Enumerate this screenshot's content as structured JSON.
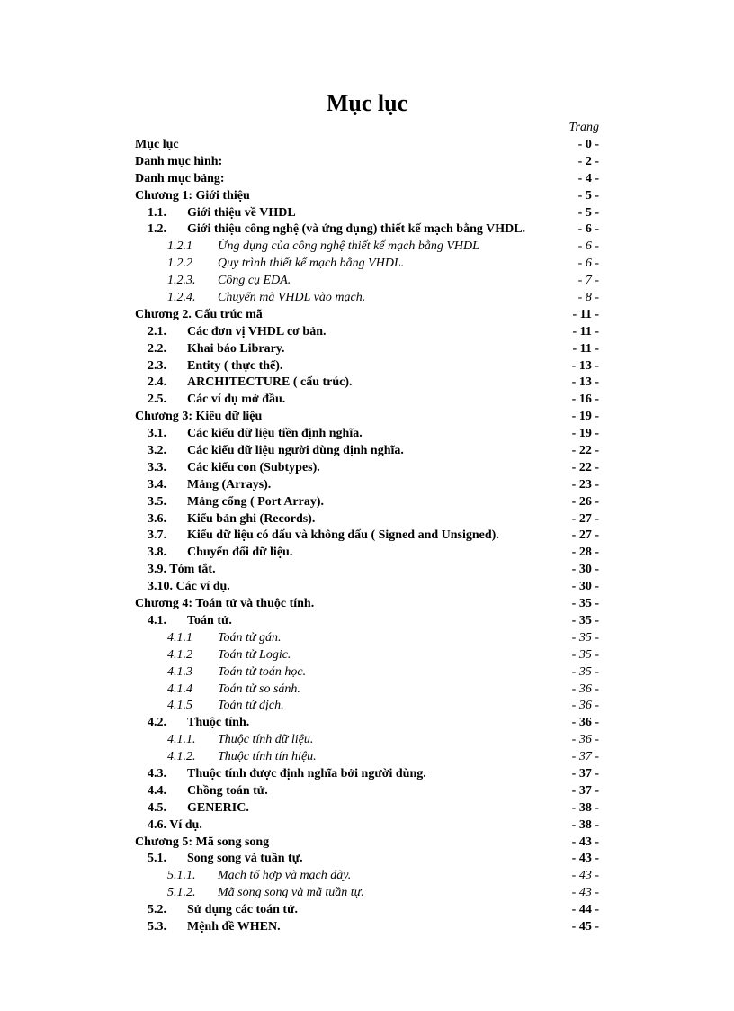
{
  "title": "Mục lục",
  "page_label": "Trang",
  "entries": [
    {
      "indent": 0,
      "bold": true,
      "italic": false,
      "num": "",
      "label": "Mục lục",
      "page": "- 0 -",
      "numClass": ""
    },
    {
      "indent": 0,
      "bold": true,
      "italic": false,
      "num": "",
      "label": "Danh mục hình:",
      "page": "- 2 -",
      "numClass": ""
    },
    {
      "indent": 0,
      "bold": true,
      "italic": false,
      "num": "",
      "label": "Danh mục bảng:",
      "page": "- 4 -",
      "numClass": ""
    },
    {
      "indent": 0,
      "bold": true,
      "italic": false,
      "num": "",
      "label": "Chương 1: Giới thiệu",
      "page": "- 5 -",
      "numClass": ""
    },
    {
      "indent": 1,
      "bold": true,
      "italic": false,
      "num": "1.1.",
      "label": "Giới thiệu về VHDL",
      "page": "- 5 -",
      "numClass": "num-col"
    },
    {
      "indent": 1,
      "bold": true,
      "italic": false,
      "num": "1.2.",
      "label": "Giới thiệu công nghệ (và ứng dụng) thiết kế mạch bằng VHDL. ",
      "page": "- 6 -",
      "numClass": "num-col",
      "shortLeader": true
    },
    {
      "indent": 2,
      "bold": false,
      "italic": true,
      "num": "1.2.1",
      "label": "Ứng dụng của công nghệ thiết kế mạch bằng VHDL",
      "page": "- 6 -",
      "numClass": "num-col-wide"
    },
    {
      "indent": 2,
      "bold": false,
      "italic": true,
      "num": "1.2.2",
      "label": "Quy trình thiết kế mạch bằng VHDL.",
      "page": "- 6 -",
      "numClass": "num-col-wide"
    },
    {
      "indent": 2,
      "bold": false,
      "italic": true,
      "num": "1.2.3.",
      "label": "Công cụ EDA.",
      "page": "- 7 -",
      "numClass": "num-col-wide"
    },
    {
      "indent": 2,
      "bold": false,
      "italic": true,
      "num": "1.2.4.",
      "label": "Chuyển mã VHDL vào mạch.",
      "page": "- 8 -",
      "numClass": "num-col-wide"
    },
    {
      "indent": 0,
      "bold": true,
      "italic": false,
      "num": "",
      "label": "Chương 2. Cấu trúc mã",
      "page": "- 11 -",
      "numClass": ""
    },
    {
      "indent": 1,
      "bold": true,
      "italic": false,
      "num": "2.1.",
      "label": "Các đơn vị VHDL cơ bản.",
      "page": "- 11 -",
      "numClass": "num-col"
    },
    {
      "indent": 1,
      "bold": true,
      "italic": false,
      "num": "2.2.",
      "label": "Khai báo Library.",
      "page": "- 11 -",
      "numClass": "num-col"
    },
    {
      "indent": 1,
      "bold": true,
      "italic": false,
      "num": "2.3.",
      "label": "Entity ( thực thể).",
      "page": "- 13 -",
      "numClass": "num-col"
    },
    {
      "indent": 1,
      "bold": true,
      "italic": false,
      "num": "2.4.",
      "label": "ARCHITECTURE ( cấu trúc).",
      "page": "- 13 -",
      "numClass": "num-col"
    },
    {
      "indent": 1,
      "bold": true,
      "italic": false,
      "num": "2.5.",
      "label": "Các ví dụ mở đầu.",
      "page": "- 16 -",
      "numClass": "num-col"
    },
    {
      "indent": 0,
      "bold": true,
      "italic": false,
      "num": "",
      "label": "Chương 3: Kiểu dữ liệu",
      "page": "- 19 -",
      "numClass": ""
    },
    {
      "indent": 1,
      "bold": true,
      "italic": false,
      "num": "3.1.",
      "label": "Các kiểu dữ liệu tiền định nghĩa.",
      "page": "- 19 -",
      "numClass": "num-col"
    },
    {
      "indent": 1,
      "bold": true,
      "italic": false,
      "num": "3.2.",
      "label": "Các kiểu dữ liệu người dùng định nghĩa.",
      "page": "- 22 -",
      "numClass": "num-col"
    },
    {
      "indent": 1,
      "bold": true,
      "italic": false,
      "num": "3.3.",
      "label": "Các kiểu con (Subtypes).",
      "page": "- 22 -",
      "numClass": "num-col"
    },
    {
      "indent": 1,
      "bold": true,
      "italic": false,
      "num": "3.4.",
      "label": "Mảng (Arrays).",
      "page": "- 23 -",
      "numClass": "num-col"
    },
    {
      "indent": 1,
      "bold": true,
      "italic": false,
      "num": "3.5.",
      "label": "Mảng cổng ( Port Array).",
      "page": "- 26 -",
      "numClass": "num-col"
    },
    {
      "indent": 1,
      "bold": true,
      "italic": false,
      "num": "3.6.",
      "label": "Kiểu bản ghi (Records).",
      "page": "- 27 -",
      "numClass": "num-col"
    },
    {
      "indent": 1,
      "bold": true,
      "italic": false,
      "num": "3.7.",
      "label": "Kiểu dữ liệu có dấu và không dấu ( Signed and Unsigned).",
      "page": "- 27 -",
      "numClass": "num-col"
    },
    {
      "indent": 1,
      "bold": true,
      "italic": false,
      "num": "3.8.",
      "label": "Chuyển đổi dữ liệu.",
      "page": "- 28 -",
      "numClass": "num-col"
    },
    {
      "indent": 1,
      "bold": true,
      "italic": false,
      "num": "",
      "label": "3.9. Tóm tắt.",
      "page": "- 30 -",
      "numClass": ""
    },
    {
      "indent": 1,
      "bold": true,
      "italic": false,
      "num": "",
      "label": "3.10. Các ví dụ.",
      "page": "- 30 -",
      "numClass": ""
    },
    {
      "indent": 0,
      "bold": true,
      "italic": false,
      "num": "",
      "label": "Chương 4: Toán tử và thuộc tính.",
      "page": "- 35 -",
      "numClass": ""
    },
    {
      "indent": 1,
      "bold": true,
      "italic": false,
      "num": "4.1.",
      "label": "Toán tử.",
      "page": "- 35 -",
      "numClass": "num-col"
    },
    {
      "indent": 2,
      "bold": false,
      "italic": true,
      "num": "4.1.1",
      "label": "Toán tử gán.",
      "page": "- 35 -",
      "numClass": "num-col-wide"
    },
    {
      "indent": 2,
      "bold": false,
      "italic": true,
      "num": "4.1.2",
      "label": "Toán tử Logic.",
      "page": "- 35 -",
      "numClass": "num-col-wide"
    },
    {
      "indent": 2,
      "bold": false,
      "italic": true,
      "num": "4.1.3",
      "label": "Toán tử toán học.",
      "page": "- 35 -",
      "numClass": "num-col-wide"
    },
    {
      "indent": 2,
      "bold": false,
      "italic": true,
      "num": "4.1.4",
      "label": "Toán tử so sánh.",
      "page": "- 36 -",
      "numClass": "num-col-wide"
    },
    {
      "indent": 2,
      "bold": false,
      "italic": true,
      "num": "4.1.5",
      "label": "Toán tử dịch.",
      "page": "- 36 -",
      "numClass": "num-col-wide"
    },
    {
      "indent": 1,
      "bold": true,
      "italic": false,
      "num": "4.2.",
      "label": "Thuộc tính.",
      "page": "- 36 -",
      "numClass": "num-col"
    },
    {
      "indent": 2,
      "bold": false,
      "italic": true,
      "num": "4.1.1.",
      "label": "Thuộc tính dữ liệu.",
      "page": "- 36 -",
      "numClass": "num-col-wide"
    },
    {
      "indent": 2,
      "bold": false,
      "italic": true,
      "num": "4.1.2.",
      "label": "Thuộc tính tín hiệu.",
      "page": "- 37 -",
      "numClass": "num-col-wide"
    },
    {
      "indent": 1,
      "bold": true,
      "italic": false,
      "num": "4.3.",
      "label": "Thuộc tính được định nghĩa bởi người dùng.",
      "page": "- 37 -",
      "numClass": "num-col"
    },
    {
      "indent": 1,
      "bold": true,
      "italic": false,
      "num": "4.4.",
      "label": "Chồng toán tử.",
      "page": "- 37 -",
      "numClass": "num-col"
    },
    {
      "indent": 1,
      "bold": true,
      "italic": false,
      "num": "4.5.",
      "label": "GENERIC.",
      "page": "- 38 -",
      "numClass": "num-col"
    },
    {
      "indent": 1,
      "bold": true,
      "italic": false,
      "num": "",
      "label": "4.6. Ví dụ.",
      "page": "- 38 -",
      "numClass": ""
    },
    {
      "indent": 0,
      "bold": true,
      "italic": false,
      "num": "",
      "label": "Chương 5: Mã song song",
      "page": "- 43 -",
      "numClass": ""
    },
    {
      "indent": 1,
      "bold": true,
      "italic": false,
      "num": "5.1.",
      "label": "Song song và tuần tự.",
      "page": "- 43 -",
      "numClass": "num-col"
    },
    {
      "indent": 2,
      "bold": false,
      "italic": true,
      "num": "5.1.1.",
      "label": "Mạch tổ hợp và mạch dãy.",
      "page": "- 43 -",
      "numClass": "num-col-wide"
    },
    {
      "indent": 2,
      "bold": false,
      "italic": true,
      "num": "5.1.2.",
      "label": "Mã song song và mã tuần tự.",
      "page": "- 43 -",
      "numClass": "num-col-wide"
    },
    {
      "indent": 1,
      "bold": true,
      "italic": false,
      "num": "5.2.",
      "label": "Sử dụng các toán tử.",
      "page": "- 44 -",
      "numClass": "num-col"
    },
    {
      "indent": 1,
      "bold": true,
      "italic": false,
      "num": "5.3.",
      "label": "Mệnh đề WHEN.",
      "page": "- 45 -",
      "numClass": "num-col"
    }
  ]
}
